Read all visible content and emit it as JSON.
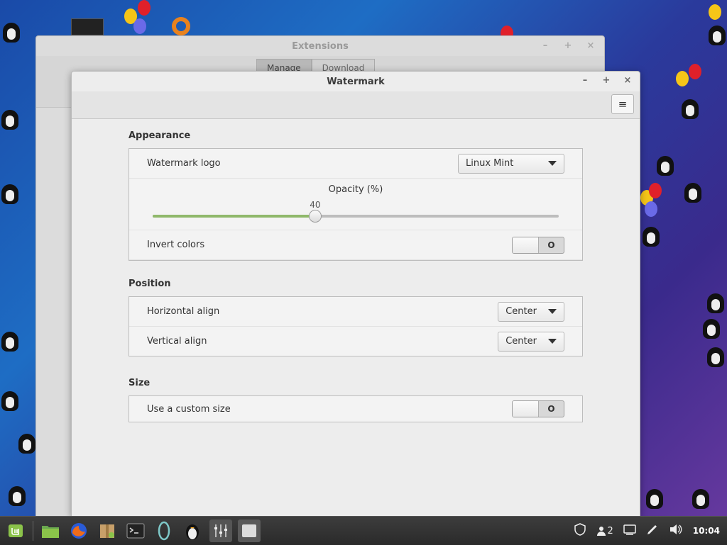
{
  "back_window": {
    "title": "Extensions",
    "tabs": [
      "Manage",
      "Download"
    ]
  },
  "window": {
    "title": "Watermark",
    "controls": {
      "minimize": "–",
      "maximize": "+",
      "close": "×"
    },
    "menu_icon": "≡"
  },
  "appearance": {
    "title": "Appearance",
    "watermark_logo_label": "Watermark logo",
    "watermark_logo_value": "Linux Mint",
    "opacity_label": "Opacity (%)",
    "opacity_value": 40,
    "opacity_text": "40",
    "invert_label": "Invert colors",
    "invert_state": "O"
  },
  "position": {
    "title": "Position",
    "horizontal_label": "Horizontal align",
    "horizontal_value": "Center",
    "vertical_label": "Vertical align",
    "vertical_value": "Center"
  },
  "size": {
    "title": "Size",
    "custom_label": "Use a custom size",
    "custom_state": "O"
  },
  "taskbar": {
    "clock": "10:04",
    "workspace": "2",
    "icons": [
      "mint-menu-icon",
      "files-icon",
      "firefox-icon",
      "archive-icon",
      "terminal-icon",
      "ring-icon",
      "penguin-icon",
      "mixer-icon",
      "blank-app-icon"
    ]
  },
  "colors": {
    "slider_fill": "#8fb86a",
    "desktop_blue": "#1e6dc4"
  }
}
